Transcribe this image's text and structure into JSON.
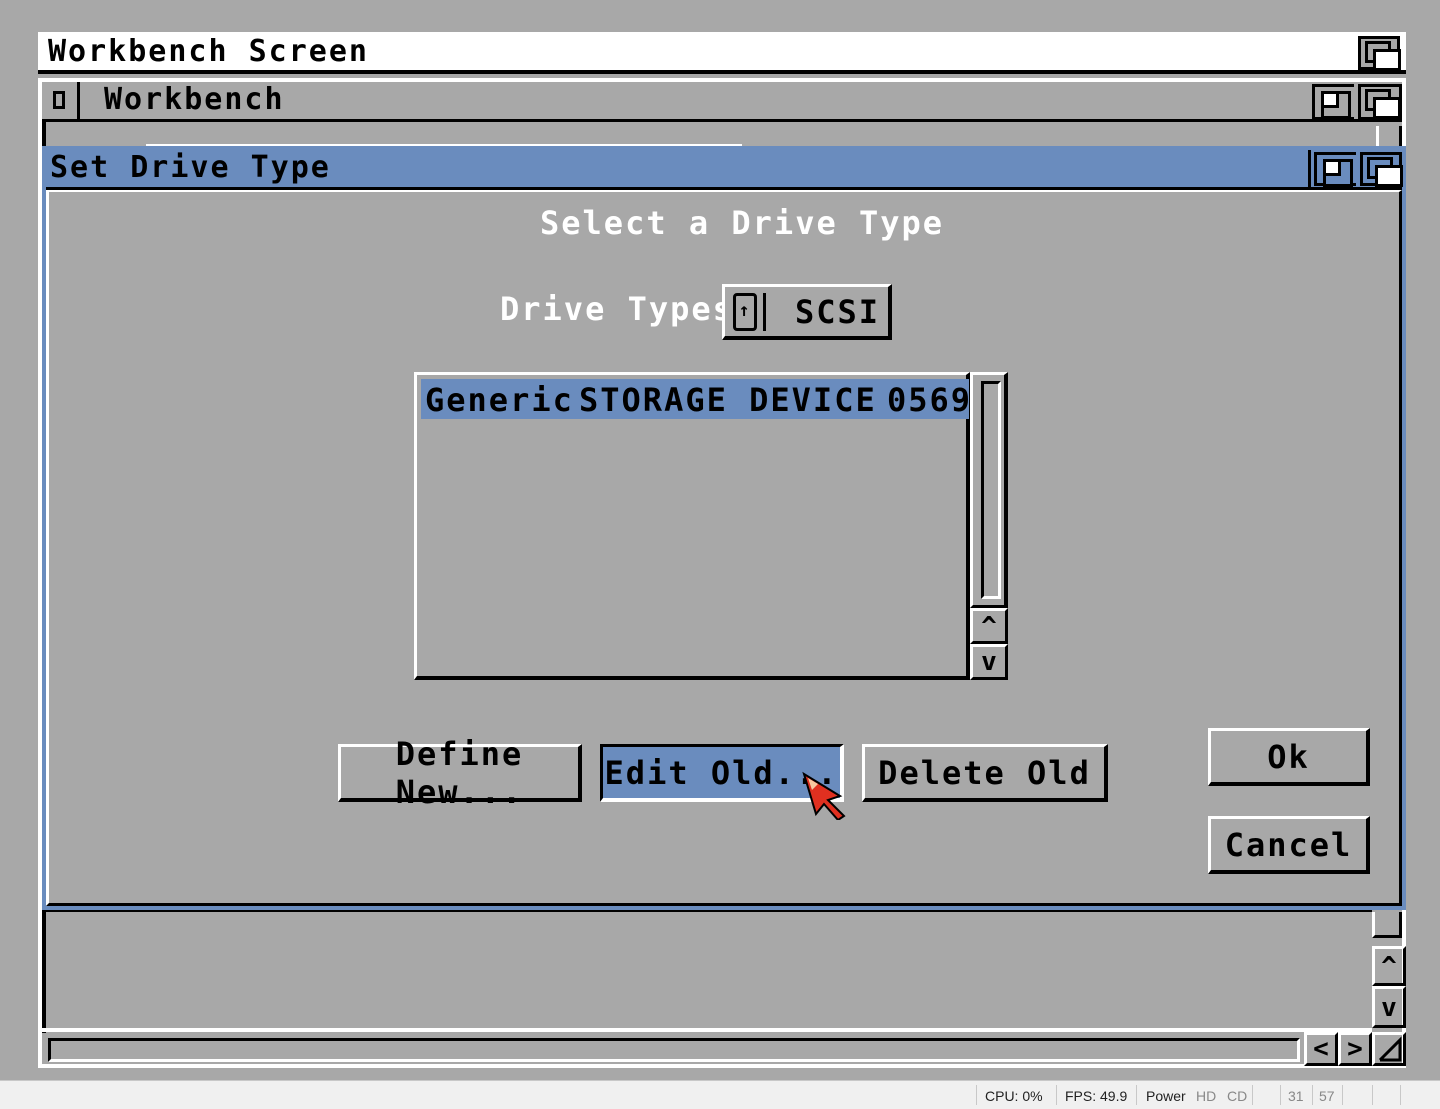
{
  "screen": {
    "title": "Workbench Screen"
  },
  "workbench_window": {
    "title": "Workbench"
  },
  "dialog": {
    "title": "Set Drive Type",
    "heading": "Select a Drive Type",
    "drive_types_label": "Drive Types:",
    "drive_types_value": "SCSI",
    "list": {
      "rows": [
        {
          "vendor": "Generic",
          "product": "STORAGE DEVICE",
          "revision": "0569",
          "selected": true
        }
      ]
    },
    "buttons": {
      "define_new": "Define New...",
      "edit_old": "Edit Old...",
      "delete_old": "Delete Old",
      "ok": "Ok",
      "cancel": "Cancel"
    }
  },
  "statusbar": {
    "cpu": "CPU: 0%",
    "fps": "FPS: 49.9",
    "power": "Power",
    "hd": "HD",
    "cd": "CD",
    "counter1": "31",
    "counter2": "57"
  },
  "colors": {
    "amiga_blue": "#6a8cbe",
    "background_grey": "#a8a8a8",
    "pointer_red": "#e03020"
  }
}
